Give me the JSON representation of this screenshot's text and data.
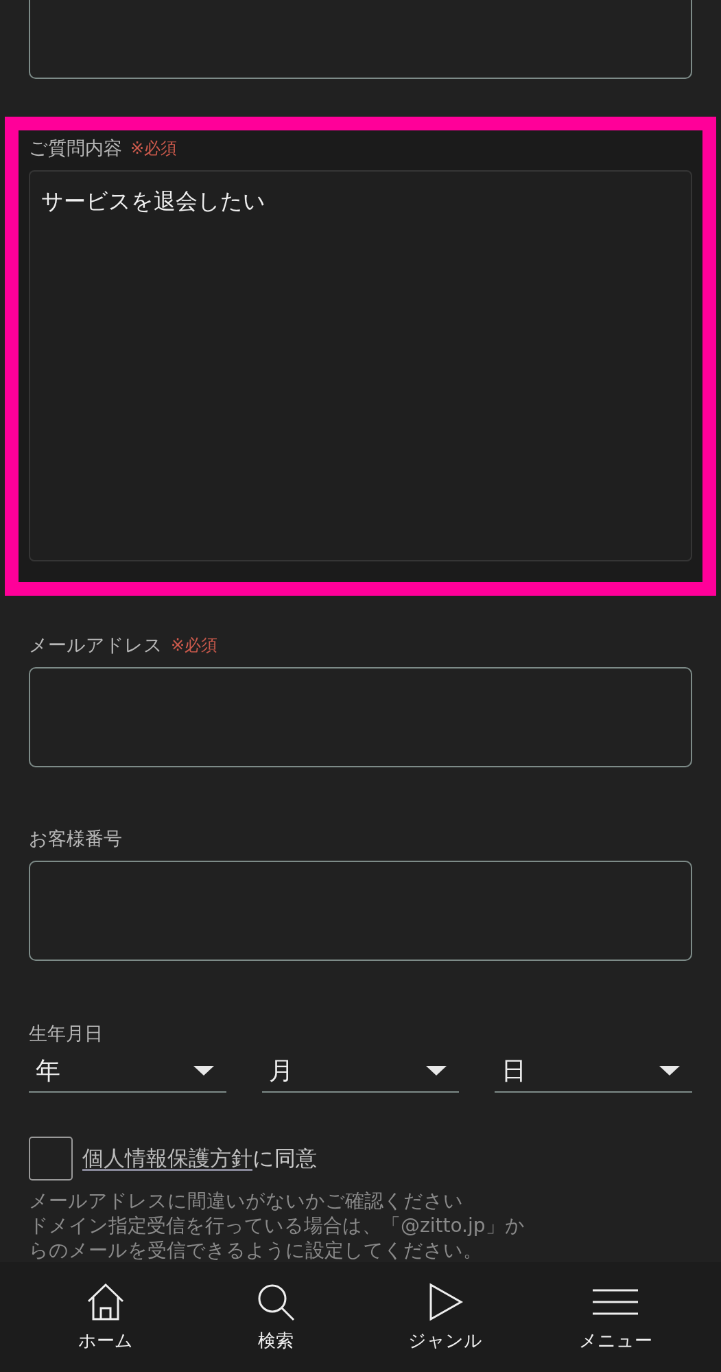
{
  "fields": [
    {
      "kind": "textarea",
      "label": "ご質問内容",
      "required_mark": "※必須",
      "value": "サービスを退会したい",
      "highlighted": true
    },
    {
      "kind": "text",
      "label": "メールアドレス",
      "required_mark": "※必須",
      "highlighted": false
    },
    {
      "kind": "text",
      "label": "お客様番号",
      "highlighted": false
    }
  ],
  "birthdate": {
    "label": "生年月日",
    "selects": [
      {
        "placeholder": "年"
      },
      {
        "placeholder": "月"
      },
      {
        "placeholder": "日"
      }
    ]
  },
  "consent": {
    "checked": false,
    "link": "個人情報保護方針",
    "text": "に同意"
  },
  "notice": {
    "lines": [
      "メールアドレスに間違いがないかご確認ください",
      "ドメイン指定受信を行っている場合は、「@zitto.jp」か",
      "らのメールを受信できるように設定してください。"
    ]
  },
  "bottom_nav": [
    {
      "label": "ホーム"
    },
    {
      "label": "検索"
    },
    {
      "label": "ジャンル"
    },
    {
      "label": "メニュー"
    }
  ]
}
